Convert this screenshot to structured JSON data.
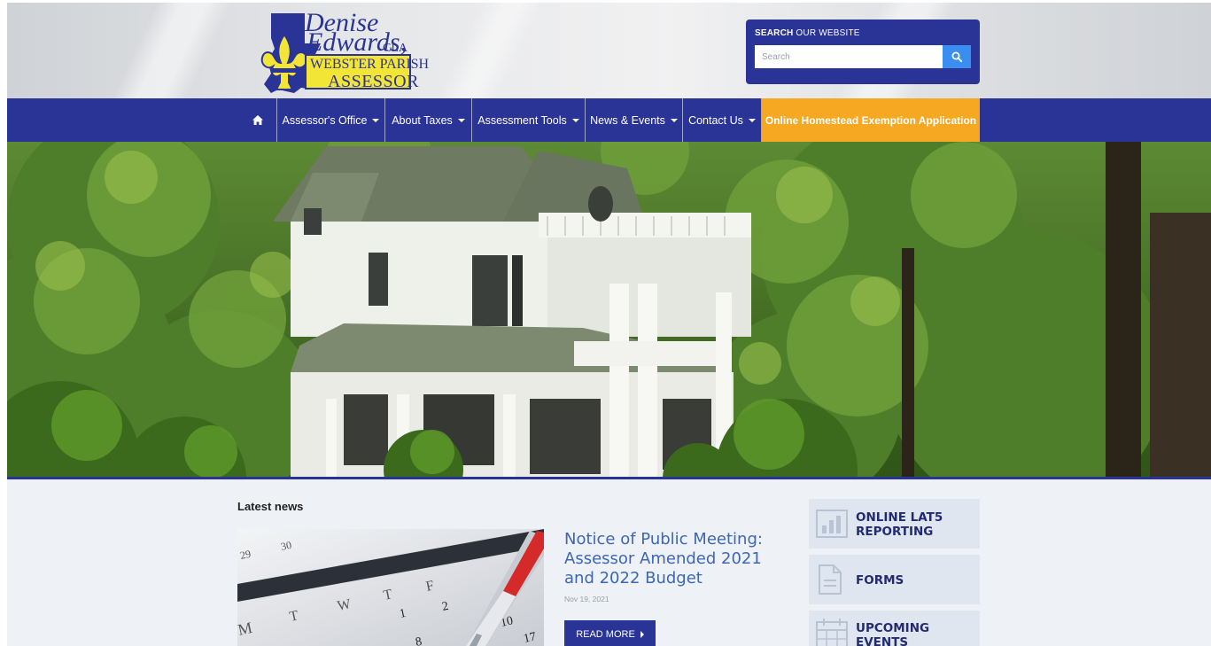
{
  "logo": {
    "name_first": "Denise",
    "name_last": "Edwards,",
    "suffix": "CLA",
    "line1": "WEBSTER PARISH",
    "line2": "ASSESSOR",
    "icon": "fleur-de-lis-icon"
  },
  "search": {
    "title_bold": "SEARCH",
    "title_rest": "OUR WEBSITE",
    "placeholder": "Search",
    "button_icon": "search-icon"
  },
  "nav": {
    "home_icon": "home-icon",
    "items": [
      {
        "label": "Assessor's Office"
      },
      {
        "label": "About Taxes"
      },
      {
        "label": "Assessment Tools"
      },
      {
        "label": "News & Events"
      },
      {
        "label": "Contact Us"
      }
    ],
    "cta_label": "Online Homestead Exemption Application"
  },
  "colors": {
    "brand_blue": "#2a3396",
    "accent_orange": "#f6a823",
    "link_blue": "#3c67b3",
    "tile_bg": "#dfe6ef"
  },
  "news": {
    "section_title": "Latest news",
    "headline": "Notice of Public Meeting: Assessor Amended 2021 and 2022 Budget",
    "date": "Nov 19, 2021",
    "read_more": "READ MORE",
    "calendar_letters": [
      "M",
      "T",
      "W",
      "T",
      "F"
    ],
    "calendar_numbers": [
      "29",
      "30",
      "1",
      "2",
      "8",
      "10",
      "17"
    ]
  },
  "quick_links": [
    {
      "line1": "ONLINE LAT5",
      "line2": "REPORTING",
      "icon": "bar-chart-icon"
    },
    {
      "line1": "FORMS",
      "line2": "",
      "icon": "document-icon"
    },
    {
      "line1": "UPCOMING",
      "line2": "EVENTS",
      "icon": "calendar-icon"
    }
  ]
}
